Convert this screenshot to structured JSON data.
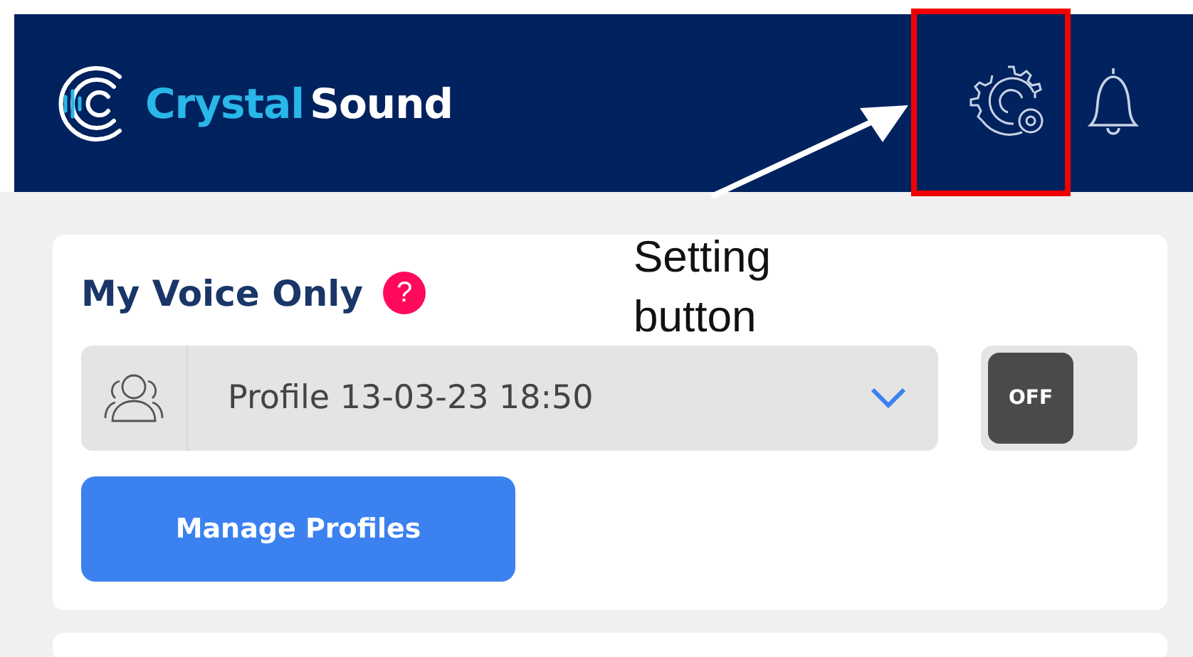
{
  "header": {
    "logo": {
      "first_word": "Crystal",
      "second_word": "Sound"
    }
  },
  "annotation": {
    "text": "Setting button"
  },
  "voice_card": {
    "title": "My Voice Only",
    "help": "?",
    "profile": {
      "value": "Profile 13-03-23 18:50"
    },
    "toggle": {
      "on": false,
      "label": "OFF"
    },
    "manage_button": "Manage Profiles"
  }
}
